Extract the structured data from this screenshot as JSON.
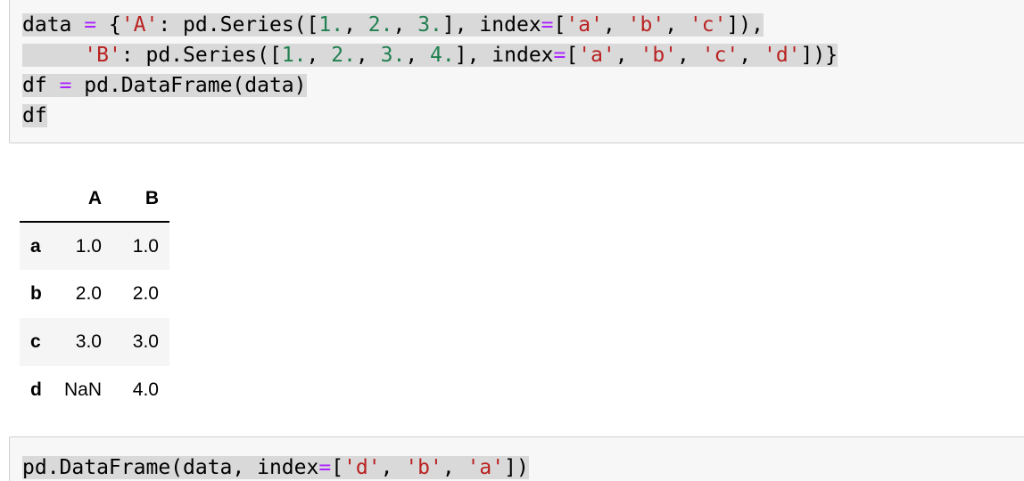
{
  "cell_1": {
    "lines": [
      [
        {
          "t": "data ",
          "k": "plain"
        },
        {
          "t": "=",
          "k": "op"
        },
        {
          "t": " {",
          "k": "plain"
        },
        {
          "t": "'A'",
          "k": "str"
        },
        {
          "t": ": pd.Series([",
          "k": "plain"
        },
        {
          "t": "1.",
          "k": "num"
        },
        {
          "t": ", ",
          "k": "plain"
        },
        {
          "t": "2.",
          "k": "num"
        },
        {
          "t": ", ",
          "k": "plain"
        },
        {
          "t": "3.",
          "k": "num"
        },
        {
          "t": "], index",
          "k": "plain"
        },
        {
          "t": "=",
          "k": "op"
        },
        {
          "t": "[",
          "k": "plain"
        },
        {
          "t": "'a'",
          "k": "str"
        },
        {
          "t": ", ",
          "k": "plain"
        },
        {
          "t": "'b'",
          "k": "str"
        },
        {
          "t": ", ",
          "k": "plain"
        },
        {
          "t": "'c'",
          "k": "str"
        },
        {
          "t": "]),",
          "k": "plain"
        }
      ],
      [
        {
          "t": "     ",
          "k": "plain"
        },
        {
          "t": "'B'",
          "k": "str"
        },
        {
          "t": ": pd.Series([",
          "k": "plain"
        },
        {
          "t": "1.",
          "k": "num"
        },
        {
          "t": ", ",
          "k": "plain"
        },
        {
          "t": "2.",
          "k": "num"
        },
        {
          "t": ", ",
          "k": "plain"
        },
        {
          "t": "3.",
          "k": "num"
        },
        {
          "t": ", ",
          "k": "plain"
        },
        {
          "t": "4.",
          "k": "num"
        },
        {
          "t": "], index",
          "k": "plain"
        },
        {
          "t": "=",
          "k": "op"
        },
        {
          "t": "[",
          "k": "plain"
        },
        {
          "t": "'a'",
          "k": "str"
        },
        {
          "t": ", ",
          "k": "plain"
        },
        {
          "t": "'b'",
          "k": "str"
        },
        {
          "t": ", ",
          "k": "plain"
        },
        {
          "t": "'c'",
          "k": "str"
        },
        {
          "t": ", ",
          "k": "plain"
        },
        {
          "t": "'d'",
          "k": "str"
        },
        {
          "t": "])}",
          "k": "plain"
        }
      ],
      [
        {
          "t": "df ",
          "k": "plain"
        },
        {
          "t": "=",
          "k": "op"
        },
        {
          "t": " pd.DataFrame(data)",
          "k": "plain"
        }
      ],
      [
        {
          "t": "df",
          "k": "plain"
        }
      ]
    ]
  },
  "output_table": {
    "columns": [
      "",
      "A",
      "B"
    ],
    "rows": [
      {
        "index": "a",
        "A": "1.0",
        "B": "1.0"
      },
      {
        "index": "b",
        "A": "2.0",
        "B": "2.0"
      },
      {
        "index": "c",
        "A": "3.0",
        "B": "3.0"
      },
      {
        "index": "d",
        "A": "NaN",
        "B": "4.0"
      }
    ]
  },
  "cell_2": {
    "lines": [
      [
        {
          "t": "pd.DataFrame(data, index",
          "k": "plain"
        },
        {
          "t": "=",
          "k": "op"
        },
        {
          "t": "[",
          "k": "plain"
        },
        {
          "t": "'d'",
          "k": "str"
        },
        {
          "t": ", ",
          "k": "plain"
        },
        {
          "t": "'b'",
          "k": "str"
        },
        {
          "t": ", ",
          "k": "plain"
        },
        {
          "t": "'a'",
          "k": "str"
        },
        {
          "t": "])",
          "k": "plain"
        }
      ]
    ]
  },
  "colors": {
    "string": "#ba2121",
    "number": "#208050",
    "operator": "#aa22ff",
    "selection": "#d9d9d9",
    "cell_background": "#f7f7f7",
    "cell_border": "#cfcfcf"
  }
}
